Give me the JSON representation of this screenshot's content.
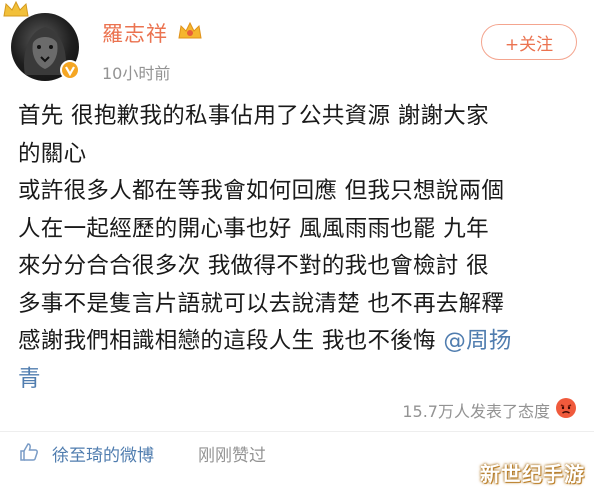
{
  "post": {
    "username": "羅志祥",
    "time": "10小时前",
    "follow_label": "+关注",
    "text_lines": [
      "首先 很抱歉我的私事佔用了公共資源 謝謝大家",
      "的關心",
      "或許很多人都在等我會如何回應 但我只想說兩個",
      "人在一起經歷的開心事也好 風風雨雨也罷 九年",
      "來分分合合很多次 我做得不對的我也會檢討 很",
      "多事不是隻言片語就可以去說清楚 也不再去解釋",
      "感謝我們相識相戀的這段人生 我也不後悔 "
    ],
    "mention_part1": "@周扬",
    "mention_part2": "青",
    "reactions": "15.7万人发表了态度",
    "liked_by": "徐至琦的微博",
    "liked_suffix": "刚刚赞过",
    "watermark": "新世纪手游"
  },
  "colors": {
    "username": "#eb7350",
    "link": "#507daf",
    "muted": "#939393",
    "text": "#1a1a1a"
  },
  "icons": {
    "crown": "crown-icon",
    "verified": "verified-badge-icon",
    "angry": "angry-face-icon",
    "like": "thumbs-up-icon"
  }
}
